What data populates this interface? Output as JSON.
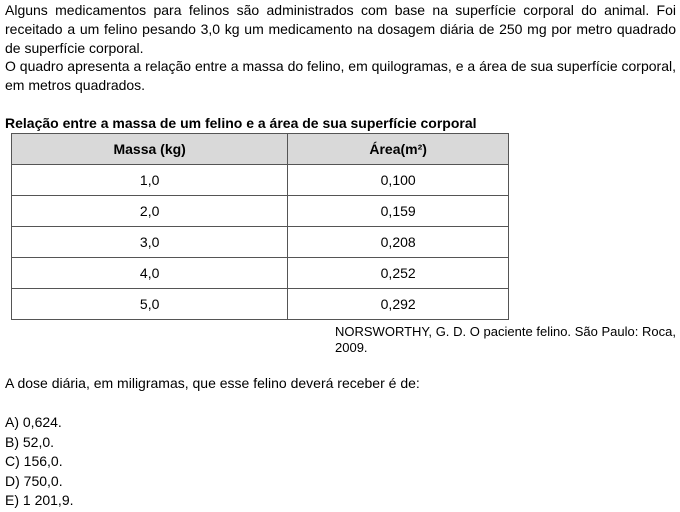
{
  "intro": {
    "paragraph1": "Alguns medicamentos para felinos são administrados com base na superfície corporal do animal. Foi receitado a um felino pesando 3,0 kg um medicamento na dosagem diária de 250 mg por metro quadrado de superfície corporal.",
    "paragraph2": "O quadro apresenta a relação entre a massa do felino, em quilogramas, e a área de sua superfície corporal, em metros quadrados."
  },
  "table": {
    "caption": "Relação entre a massa de um felino e a área de sua superfície corporal",
    "headers": [
      "Massa (kg)",
      "Área(m²)"
    ],
    "rows": [
      [
        "1,0",
        "0,100"
      ],
      [
        "2,0",
        "0,159"
      ],
      [
        "3,0",
        "0,208"
      ],
      [
        "4,0",
        "0,252"
      ],
      [
        "5,0",
        "0,292"
      ]
    ],
    "source": "NORSWORTHY, G. D. O paciente felino. São Paulo: Roca, 2009."
  },
  "question": "A dose diária, em miligramas, que esse felino deverá receber é de:",
  "options": [
    "A) 0,624.",
    "B) 52,0.",
    "C) 156,0.",
    "D) 750,0.",
    "E) 1 201,9."
  ]
}
